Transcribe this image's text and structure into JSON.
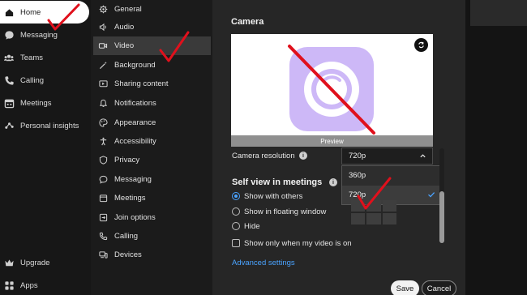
{
  "nav": {
    "items": [
      {
        "label": "Home",
        "icon": "home-icon",
        "active": true
      },
      {
        "label": "Messaging",
        "icon": "chat-icon"
      },
      {
        "label": "Teams",
        "icon": "teams-icon"
      },
      {
        "label": "Calling",
        "icon": "phone-icon"
      },
      {
        "label": "Meetings",
        "icon": "calendar-icon"
      },
      {
        "label": "Personal insights",
        "icon": "insights-icon"
      }
    ],
    "bottom": [
      {
        "label": "Upgrade",
        "icon": "crown-icon"
      },
      {
        "label": "Apps",
        "icon": "apps-icon"
      }
    ]
  },
  "categories": [
    {
      "label": "General",
      "icon": "gear-icon"
    },
    {
      "label": "Audio",
      "icon": "speaker-icon"
    },
    {
      "label": "Video",
      "icon": "video-icon",
      "active": true
    },
    {
      "label": "Background",
      "icon": "wand-icon"
    },
    {
      "label": "Sharing content",
      "icon": "share-icon"
    },
    {
      "label": "Notifications",
      "icon": "bell-icon"
    },
    {
      "label": "Appearance",
      "icon": "palette-icon"
    },
    {
      "label": "Accessibility",
      "icon": "accessibility-icon"
    },
    {
      "label": "Privacy",
      "icon": "shield-icon"
    },
    {
      "label": "Messaging",
      "icon": "chat-icon"
    },
    {
      "label": "Meetings",
      "icon": "calendar-icon"
    },
    {
      "label": "Join options",
      "icon": "join-icon"
    },
    {
      "label": "Calling",
      "icon": "phone-icon"
    },
    {
      "label": "Devices",
      "icon": "devices-icon"
    }
  ],
  "camera": {
    "title": "Camera",
    "preview_label": "Preview",
    "resolution_label": "Camera resolution",
    "resolution_value": "720p",
    "options": [
      "360p",
      "720p"
    ],
    "selected_option": "720p"
  },
  "self_view": {
    "title": "Self view in meetings",
    "options": [
      "Show with others",
      "Show in floating window",
      "Hide"
    ],
    "selected": "Show with others",
    "checkbox_label": "Show only when my video is on"
  },
  "advanced_link": "Advanced settings",
  "buttons": {
    "save": "Save",
    "cancel": "Cancel"
  },
  "colors": {
    "accent": "#4aa3ff",
    "annotation": "#e0101c",
    "camera_icon": "#cdb8f7"
  }
}
